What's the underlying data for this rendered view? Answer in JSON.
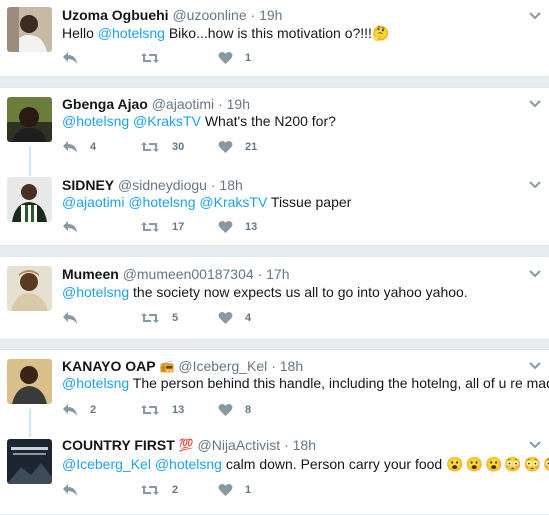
{
  "tweets": [
    {
      "name": "Uzoma Ogbuehi",
      "handle": "@uzoonline",
      "time": "19h",
      "segments": [
        {
          "t": "Hello "
        },
        {
          "t": "@hotelsng",
          "m": true
        },
        {
          "t": " Biko...how is this motivation o?!!!"
        }
      ],
      "trailing_emoji": "🤔",
      "replies": "",
      "retweets": "",
      "likes": "1"
    },
    {
      "name": "Gbenga Ajao",
      "handle": "@ajaotimi",
      "time": "19h",
      "segments": [
        {
          "t": "@hotelsng",
          "m": true
        },
        {
          "t": " "
        },
        {
          "t": "@KraksTV",
          "m": true
        },
        {
          "t": " What's the N200 for?"
        }
      ],
      "replies": "4",
      "retweets": "30",
      "likes": "21"
    },
    {
      "name": "SIDNEY",
      "handle": "@sidneydiogu",
      "time": "18h",
      "segments": [
        {
          "t": "@ajaotimi",
          "m": true
        },
        {
          "t": " "
        },
        {
          "t": "@hotelsng",
          "m": true
        },
        {
          "t": " "
        },
        {
          "t": "@KraksTV",
          "m": true
        },
        {
          "t": " Tissue paper"
        }
      ],
      "replies": "",
      "retweets": "17",
      "likes": "13"
    },
    {
      "name": "Mumeen",
      "handle": "@mumeen00187304",
      "time": "17h",
      "segments": [
        {
          "t": "@hotelsng",
          "m": true
        },
        {
          "t": " the society now expects us all to go into yahoo yahoo."
        }
      ],
      "replies": "",
      "retweets": "5",
      "likes": "4"
    },
    {
      "name": "KANAYO OAP",
      "name_badge": "📻",
      "handle": "@Iceberg_Kel",
      "time": "18h",
      "segments": [
        {
          "t": "@hotelsng",
          "m": true
        },
        {
          "t": " The person behind this handle, including the hotelng, all of u re mad!!!"
        }
      ],
      "replies": "2",
      "retweets": "13",
      "likes": "8"
    },
    {
      "name": "COUNTRY FIRST",
      "name_badge": "💯",
      "handle": "@NijaActivist",
      "time": "18h",
      "segments": [
        {
          "t": "@Iceberg_Kel",
          "m": true
        },
        {
          "t": " "
        },
        {
          "t": "@hotelsng",
          "m": true
        },
        {
          "t": " calm down. Person carry your food "
        }
      ],
      "emoji_row": [
        "😮",
        "😮",
        "😮",
        "😳",
        "😳",
        "😳"
      ],
      "replies": "",
      "retweets": "2",
      "likes": "1"
    }
  ],
  "separator": "·",
  "colors": {
    "mention": "#1da1f2",
    "meta": "#657786",
    "background": "#e6ecf0",
    "thread_line": "#cbe8fb"
  },
  "icons": {
    "reply": "reply-icon",
    "retweet": "retweet-icon",
    "like": "heart-icon",
    "more": "chevron-down-icon"
  }
}
